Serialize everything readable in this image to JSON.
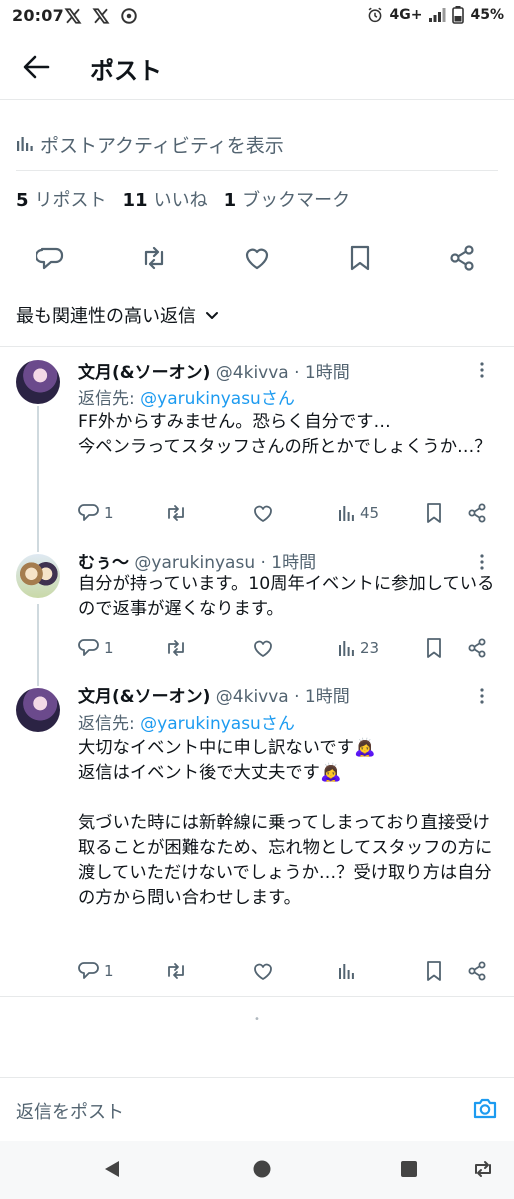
{
  "status_bar": {
    "time": "20:07",
    "network": "4G+",
    "battery": "45%",
    "icons": [
      "x-logo-icon",
      "x-logo-icon",
      "app-notification-icon",
      "alarm-icon",
      "signal-icon",
      "battery-icon"
    ]
  },
  "header": {
    "title": "ポスト",
    "back_icon": "arrow-left-icon"
  },
  "activity": {
    "label": "ポストアクティビティを表示",
    "icon": "bar-chart-icon"
  },
  "stats": {
    "reposts_count": "5",
    "reposts_label": "リポスト",
    "likes_count": "11",
    "likes_label": "いいね",
    "bookmarks_count": "1",
    "bookmarks_label": "ブックマーク"
  },
  "sort": {
    "label": "最も関連性の高い返信",
    "icon": "chevron-down-icon"
  },
  "replies": [
    {
      "name": "文月(&ソーオン)",
      "handle_time": "@4kivva · 1時間",
      "reply_to_prefix": "返信先: ",
      "reply_to": "@yarukinyasuさん",
      "text": "FF外からすみません。恐らく自分です…\n今ペンラってスタッフさんの所とかでしょくうか…？",
      "reply_count": "1",
      "view_count": "45"
    },
    {
      "name": "むぅ〜",
      "handle_time": "@yarukinyasu · 1時間",
      "text": "自分が持っています。10周年イベントに参加しているので返事が遅くなります。",
      "reply_count": "1",
      "view_count": "23"
    },
    {
      "name": "文月(&ソーオン)",
      "handle_time": "@4kivva · 1時間",
      "reply_to_prefix": "返信先: ",
      "reply_to": "@yarukinyasuさん",
      "text": "大切なイベント中に申し訳ないです🙇‍♀️\n返信はイベント後で大丈夫です🙇‍♀️\n\n気づいた時には新幹線に乗ってしまっており直接受け取ることが困難なため、忘れ物としてスタッフの方に渡していただけないでしょうか…？受け取り方は自分の方から問い合わせします。",
      "reply_count": "1",
      "view_count": ""
    }
  ],
  "loading_indicator": "•",
  "composer": {
    "placeholder": "返信をポスト",
    "icon": "camera-icon"
  },
  "navbar": {
    "icons": [
      "back-triangle-icon",
      "home-circle-icon",
      "recents-square-icon",
      "rotate-icon"
    ]
  },
  "colors": {
    "accent": "#1d9bf0",
    "text": "#0f1419",
    "muted": "#536471",
    "divider": "#e7e9ea"
  }
}
